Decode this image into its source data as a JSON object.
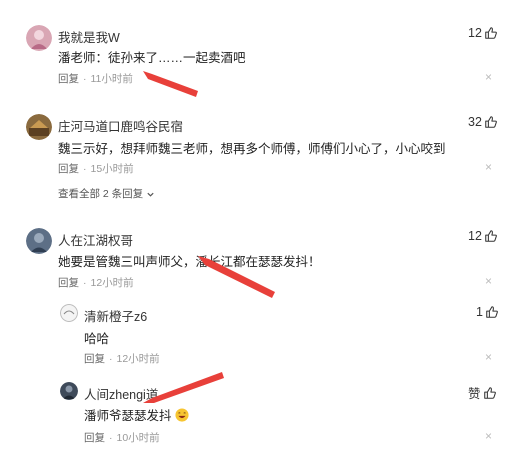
{
  "comments": [
    {
      "user": "我就是我W",
      "text": "潘老师：徒孙来了……一起卖酒吧",
      "reply_label": "回复",
      "time": "11小时前",
      "likes": "12"
    },
    {
      "user": "庄河马道口鹿鸣谷民宿",
      "text": "魏三示好，想拜师魏三老师，想再多个师傅，师傅们小心了，小心咬到",
      "reply_label": "回复",
      "time": "15小时前",
      "likes": "32",
      "expand_label": "查看全部 2 条回复"
    },
    {
      "user": "人在江湖权哥",
      "text": "她要是管魏三叫声师父，潘长江都在瑟瑟发抖！",
      "reply_label": "回复",
      "time": "12小时前",
      "likes": "12",
      "replies": [
        {
          "user": "清新橙子z6",
          "text": "哈哈",
          "reply_label": "回复",
          "time": "12小时前",
          "likes": "1"
        },
        {
          "user": "人间zhengi道",
          "text": "潘师爷瑟瑟发抖",
          "reply_label": "回复",
          "time": "10小时前",
          "likes": "赞"
        }
      ]
    }
  ],
  "close_glyph": "×",
  "icons": {
    "like": "thumb-up-icon",
    "close": "close-icon",
    "chevron": "chevron-down-icon",
    "emoji": "laughing-emoji-icon"
  },
  "colors": {
    "arrow": "#e8403a",
    "meta": "#999999",
    "text": "#222222"
  }
}
